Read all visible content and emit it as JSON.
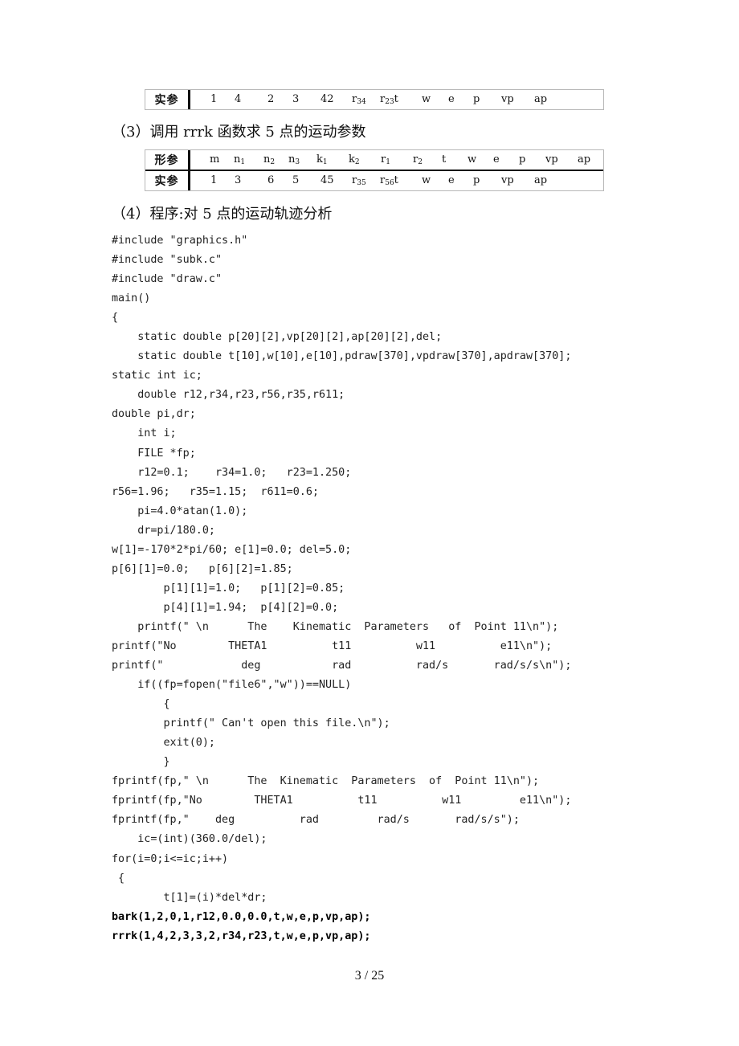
{
  "table_top": {
    "row_label": "实参",
    "cells": [
      {
        "text": "1"
      },
      {
        "text": "4"
      },
      {
        "text": "2"
      },
      {
        "text": "3"
      },
      {
        "text": "42"
      },
      {
        "base": "r",
        "sub": "34"
      },
      {
        "base": "r",
        "sub": "23",
        "suffix": "t"
      },
      {
        "text": "w"
      },
      {
        "text": "e"
      },
      {
        "text": "p"
      },
      {
        "text": "vp"
      },
      {
        "text": "ap"
      }
    ]
  },
  "section3": {
    "heading": "（3）调用 rrrk 函数求 5 点的运动参数"
  },
  "table_rrrk": {
    "formal_label": "形参",
    "actual_label": "实参",
    "formal": [
      {
        "text": "m"
      },
      {
        "base": "n",
        "sub": "1"
      },
      {
        "base": "n",
        "sub": "2"
      },
      {
        "base": "n",
        "sub": "3"
      },
      {
        "base": "k",
        "sub": "1"
      },
      {
        "base": "k",
        "sub": "2"
      },
      {
        "base": "r",
        "sub": "1"
      },
      {
        "base": "r",
        "sub": "2"
      },
      {
        "text": "t"
      },
      {
        "text": "w"
      },
      {
        "text": "e"
      },
      {
        "text": "p"
      },
      {
        "text": "vp"
      },
      {
        "text": "ap"
      }
    ],
    "actual": [
      {
        "text": "1"
      },
      {
        "text": "3"
      },
      {
        "text": "6"
      },
      {
        "text": "5"
      },
      {
        "text": "45"
      },
      {
        "base": "r",
        "sub": "35"
      },
      {
        "base": "r",
        "sub": "56",
        "suffix": "t"
      },
      {
        "text": "w"
      },
      {
        "text": "e"
      },
      {
        "text": "p"
      },
      {
        "text": "vp"
      },
      {
        "text": "ap"
      }
    ]
  },
  "section4": {
    "heading": "（4）程序:对 5 点的运动轨迹分析"
  },
  "code_lines": [
    {
      "text": "#include \"graphics.h\""
    },
    {
      "text": "#include \"subk.c\""
    },
    {
      "text": "#include \"draw.c\""
    },
    {
      "text": "main()"
    },
    {
      "text": "{"
    },
    {
      "text": "    static double p[20][2],vp[20][2],ap[20][2],del;"
    },
    {
      "text": "    static double t[10],w[10],e[10],pdraw[370],vpdraw[370],apdraw[370];"
    },
    {
      "text": "static int ic;"
    },
    {
      "text": "    double r12,r34,r23,r56,r35,r611;"
    },
    {
      "text": "double pi,dr;"
    },
    {
      "text": "    int i;"
    },
    {
      "text": "    FILE *fp;"
    },
    {
      "text": "    r12=0.1;    r34=1.0;   r23=1.250;"
    },
    {
      "text": "r56=1.96;   r35=1.15;  r611=0.6;"
    },
    {
      "text": "    pi=4.0*atan(1.0);"
    },
    {
      "text": "    dr=pi/180.0;"
    },
    {
      "text": "w[1]=-170*2*pi/60; e[1]=0.0; del=5.0;"
    },
    {
      "text": "p[6][1]=0.0;   p[6][2]=1.85;"
    },
    {
      "text": "        p[1][1]=1.0;   p[1][2]=0.85;"
    },
    {
      "text": "        p[4][1]=1.94;  p[4][2]=0.0;"
    },
    {
      "text": "    printf(\" \\n      The    Kinematic  Parameters   of  Point 11\\n\");"
    },
    {
      "text": "printf(\"No        THETA1          t11          w11          e11\\n\");"
    },
    {
      "text": "printf(\"            deg           rad          rad/s       rad/s/s\\n\");"
    },
    {
      "text": "    if((fp=fopen(\"file6\",\"w\"))==NULL)"
    },
    {
      "text": "        {"
    },
    {
      "text": "        printf(\" Can't open this file.\\n\");"
    },
    {
      "text": "        exit(0);"
    },
    {
      "text": "        }"
    },
    {
      "text": "fprintf(fp,\" \\n      The  Kinematic  Parameters  of  Point 11\\n\");"
    },
    {
      "text": "fprintf(fp,\"No        THETA1          t11          w11         e11\\n\");"
    },
    {
      "text": "fprintf(fp,\"    deg          rad         rad/s       rad/s/s\");"
    },
    {
      "text": "    ic=(int)(360.0/del);"
    },
    {
      "text": "for(i=0;i<=ic;i++)"
    },
    {
      "text": " {"
    },
    {
      "text": "        t[1]=(i)*del*dr;"
    },
    {
      "text": "bark(1,2,0,1,r12,0.0,0.0,t,w,e,p,vp,ap);",
      "bold": true
    },
    {
      "text": "rrrk(1,4,2,3,3,2,r34,r23,t,w,e,p,vp,ap);",
      "bold": true
    }
  ],
  "footer": {
    "page_indicator": "3  / 25"
  }
}
